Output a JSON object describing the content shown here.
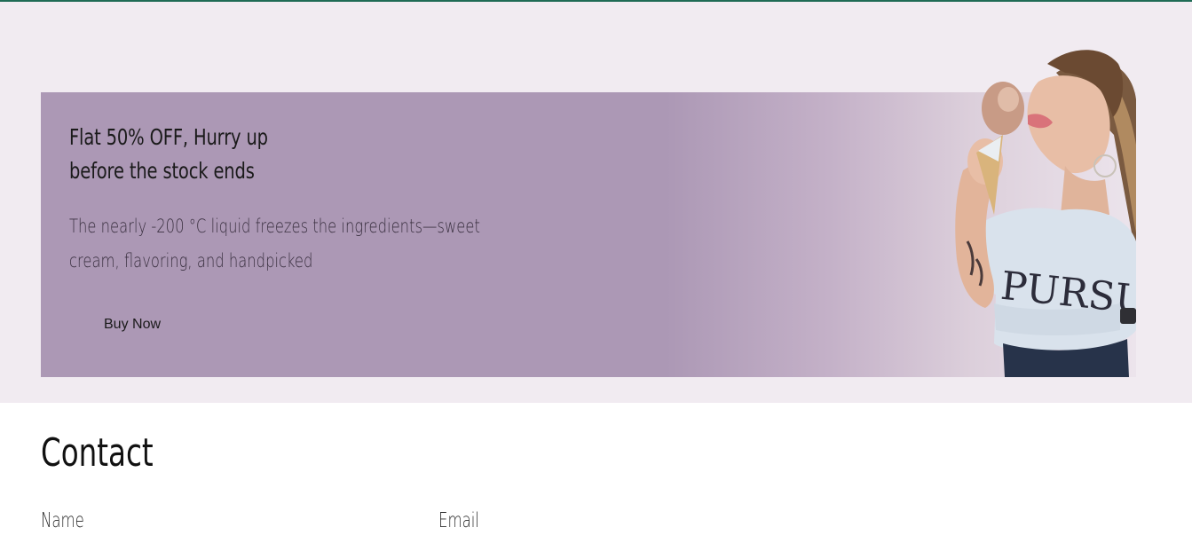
{
  "promo": {
    "title": "Flat 50% OFF, Hurry up before the stock ends",
    "description": "The nearly -200 °C liquid freezes the ingredients—sweet cream, flavoring, and handpicked",
    "button_label": "Buy Now",
    "shirt_text": "PURSUIT"
  },
  "contact": {
    "heading": "Contact",
    "name_label": "Name",
    "email_label": "Email"
  },
  "colors": {
    "top_rule": "#1f6b55",
    "section_bg": "#f1ebf1",
    "banner_purple": "#ac98b5"
  },
  "icons": {
    "hero_image": "woman-with-ice-cream-photo"
  }
}
